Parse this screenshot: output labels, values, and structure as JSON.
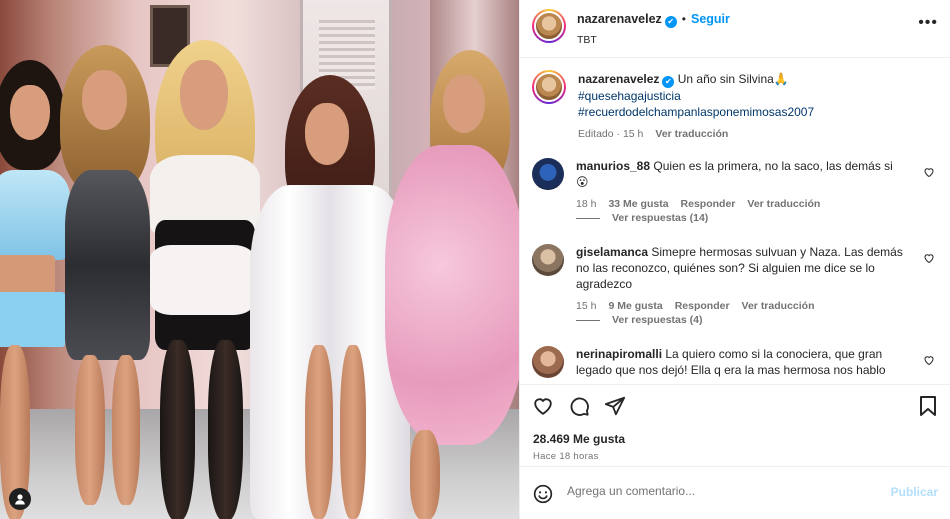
{
  "post": {
    "username": "nazarenavelez",
    "separator": "•",
    "follow_label": "Seguir",
    "subtitle": "TBT",
    "more_label": "•••",
    "verified_mark": "✔"
  },
  "caption": {
    "username": "nazarenavelez",
    "text": "Un año sin Silvina🙏",
    "hashtag1": "#quesehagajusticia",
    "hashtag2": "#recuerdodelchampanlasponemimosas2007",
    "edited": "Editado · 15 h",
    "translate": "Ver traducción"
  },
  "comments": [
    {
      "username": "manurios_88",
      "text": "Quien es la primera, no la saco, las demás si 😮",
      "time": "18 h",
      "likes": "33 Me gusta",
      "reply": "Responder",
      "translate": "Ver traducción",
      "replies": "Ver respuestas (14)"
    },
    {
      "username": "giselamanca",
      "text": "Simepre hermosas sulvuan y Naza. Las demás no las reconozco, quiénes son? Si alguien me dice se lo agradezco",
      "time": "15 h",
      "likes": "9 Me gusta",
      "reply": "Responder",
      "translate": "Ver traducción",
      "replies": "Ver respuestas (4)"
    },
    {
      "username": "nerinapiromalli",
      "text": "La quiero como si la conociera, que gran legado que nos dejó! Ella q era la mas hermosa nos hablo"
    }
  ],
  "actions": {
    "likes": "28.469 Me gusta",
    "time": "Hace 18 horas"
  },
  "add_comment": {
    "placeholder": "Agrega un comentario...",
    "publish_label": "Publicar"
  },
  "colors": {
    "accent": "#0095f6",
    "hashtag": "#00376b",
    "muted": "#737373"
  }
}
